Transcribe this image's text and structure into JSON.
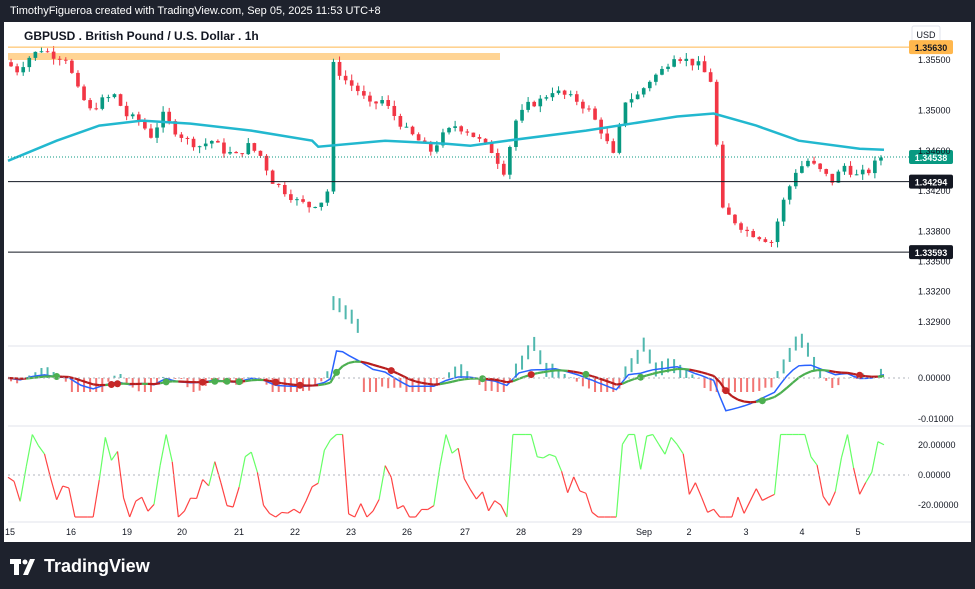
{
  "header": {
    "created_by": "TimothyFigueroa created with TradingView.com, Sep 05, 2025 11:53 UTC+8"
  },
  "chart": {
    "title": "GBPUSD . British Pound / U.S. Dollar . 1h",
    "currency": "USD"
  },
  "footer": {
    "brand": "TradingView"
  },
  "colors": {
    "up": "#089981",
    "down": "#f23645",
    "ma": "#22b8cf",
    "orange_line": "#ffb74d",
    "macd": "#2962ff",
    "signal_up": "#4caf50",
    "signal_down": "#b71c1c",
    "osc_up": "#66ff66",
    "osc_down": "#ff4444"
  },
  "chart_data": [
    {
      "type": "candlestick",
      "panel": "price",
      "y_ticks": [
        "1.35500",
        "1.35000",
        "1.34600",
        "1.34200",
        "1.33800",
        "1.33500",
        "1.33200",
        "1.32900"
      ],
      "ylim": [
        1.327,
        1.3578
      ],
      "x_ticks": [
        "15",
        "16",
        "19",
        "20",
        "21",
        "22",
        "23",
        "26",
        "27",
        "28",
        "29",
        "Sep",
        "2",
        "3",
        "4",
        "5"
      ],
      "price_labels": [
        {
          "label": "1.35630",
          "value": 1.3563,
          "style": "orange"
        },
        {
          "label": "1.34538",
          "value": 1.34538,
          "style": "teal"
        },
        {
          "label": "1.34294",
          "value": 1.34294,
          "style": "black"
        },
        {
          "label": "1.33593",
          "value": 1.33593,
          "style": "black"
        }
      ],
      "horizontal_lines": [
        1.3563,
        1.34294,
        1.33593
      ],
      "ma_path": [
        [
          0,
          1.345
        ],
        [
          8,
          1.347
        ],
        [
          15,
          1.3485
        ],
        [
          22,
          1.349
        ],
        [
          30,
          1.3487
        ],
        [
          40,
          1.348
        ],
        [
          50,
          1.347
        ],
        [
          51,
          1.3464
        ],
        [
          62,
          1.347
        ],
        [
          72,
          1.3467
        ],
        [
          76,
          1.3465
        ],
        [
          82,
          1.347
        ],
        [
          95,
          1.348
        ],
        [
          110,
          1.3494
        ],
        [
          116,
          1.3497
        ],
        [
          123,
          1.3485
        ],
        [
          130,
          1.347
        ],
        [
          140,
          1.3462
        ],
        [
          144,
          1.3461
        ]
      ],
      "close_path": [
        [
          0,
          1.3548
        ],
        [
          2,
          1.354
        ],
        [
          4,
          1.3553
        ],
        [
          6,
          1.3561
        ],
        [
          8,
          1.3555
        ],
        [
          10,
          1.3552
        ],
        [
          12,
          1.352
        ],
        [
          14,
          1.35
        ],
        [
          16,
          1.351
        ],
        [
          18,
          1.3515
        ],
        [
          20,
          1.3495
        ],
        [
          22,
          1.349
        ],
        [
          24,
          1.3475
        ],
        [
          26,
          1.3495
        ],
        [
          28,
          1.348
        ],
        [
          30,
          1.347
        ],
        [
          32,
          1.3465
        ],
        [
          34,
          1.347
        ],
        [
          36,
          1.346
        ],
        [
          38,
          1.3455
        ],
        [
          40,
          1.3465
        ],
        [
          42,
          1.3455
        ],
        [
          44,
          1.343
        ],
        [
          46,
          1.342
        ],
        [
          48,
          1.341
        ],
        [
          50,
          1.3405
        ],
        [
          52,
          1.341
        ],
        [
          53,
          1.342
        ],
        [
          54,
          1.3545
        ],
        [
          56,
          1.353
        ],
        [
          58,
          1.352
        ],
        [
          60,
          1.3505
        ],
        [
          62,
          1.351
        ],
        [
          64,
          1.3495
        ],
        [
          66,
          1.348
        ],
        [
          68,
          1.347
        ],
        [
          70,
          1.346
        ],
        [
          72,
          1.3475
        ],
        [
          74,
          1.3485
        ],
        [
          76,
          1.348
        ],
        [
          78,
          1.347
        ],
        [
          80,
          1.346
        ],
        [
          82,
          1.344
        ],
        [
          84,
          1.349
        ],
        [
          86,
          1.3505
        ],
        [
          88,
          1.351
        ],
        [
          90,
          1.352
        ],
        [
          92,
          1.3515
        ],
        [
          94,
          1.351
        ],
        [
          96,
          1.35
        ],
        [
          98,
          1.348
        ],
        [
          100,
          1.3455
        ],
        [
          102,
          1.351
        ],
        [
          104,
          1.3515
        ],
        [
          106,
          1.353
        ],
        [
          108,
          1.354
        ],
        [
          110,
          1.3555
        ],
        [
          112,
          1.355
        ],
        [
          114,
          1.3545
        ],
        [
          116,
          1.353
        ],
        [
          118,
          1.34
        ],
        [
          120,
          1.339
        ],
        [
          122,
          1.338
        ],
        [
          124,
          1.3375
        ],
        [
          126,
          1.337
        ],
        [
          128,
          1.341
        ],
        [
          130,
          1.344
        ],
        [
          132,
          1.345
        ],
        [
          134,
          1.344
        ],
        [
          136,
          1.343
        ],
        [
          138,
          1.3445
        ],
        [
          140,
          1.3435
        ],
        [
          142,
          1.344
        ],
        [
          144,
          1.3454
        ]
      ]
    },
    {
      "type": "line",
      "panel": "macd",
      "y_ticks": [
        "0.00000",
        "-0.01000"
      ],
      "signal_points": [
        [
          8,
          "up"
        ],
        [
          17,
          "down"
        ],
        [
          18,
          "down"
        ],
        [
          26,
          "up"
        ],
        [
          32,
          "down"
        ],
        [
          34,
          "up"
        ],
        [
          36,
          "up"
        ],
        [
          38,
          "up"
        ],
        [
          44,
          "down"
        ],
        [
          48,
          "down"
        ],
        [
          54,
          "up"
        ],
        [
          63,
          "down"
        ],
        [
          78,
          "up"
        ],
        [
          86,
          "down"
        ],
        [
          95,
          "up"
        ],
        [
          104,
          "up"
        ],
        [
          118,
          "down"
        ],
        [
          124,
          "up"
        ],
        [
          140,
          "down"
        ]
      ]
    },
    {
      "type": "line",
      "panel": "oscillator",
      "y_ticks": [
        "20.00000",
        "0.00000",
        "-20.00000"
      ],
      "ylim": [
        -30,
        30
      ]
    }
  ]
}
